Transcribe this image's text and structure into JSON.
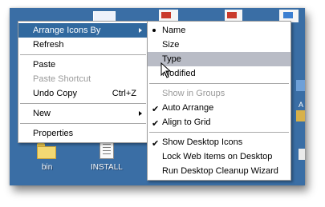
{
  "desktop": {
    "icons": [
      {
        "label": "bin"
      },
      {
        "label": "INSTALL"
      }
    ],
    "edge_label_partial": "A"
  },
  "context_menu": {
    "items": [
      {
        "label": "Arrange Icons By"
      },
      {
        "label": "Refresh"
      },
      {
        "label": "Paste"
      },
      {
        "label": "Paste Shortcut"
      },
      {
        "label": "Undo Copy",
        "shortcut": "Ctrl+Z"
      },
      {
        "label": "New"
      },
      {
        "label": "Properties"
      }
    ]
  },
  "submenu": {
    "items": [
      {
        "label": "Name"
      },
      {
        "label": "Size"
      },
      {
        "label": "Type"
      },
      {
        "label": "Modified"
      },
      {
        "label": "Show in Groups"
      },
      {
        "label": "Auto Arrange"
      },
      {
        "label": "Align to Grid"
      },
      {
        "label": "Show Desktop Icons"
      },
      {
        "label": "Lock Web Items on Desktop"
      },
      {
        "label": "Run Desktop Cleanup Wizard"
      }
    ]
  },
  "colors": {
    "desktop": "#3a6ea5",
    "highlight": "#31699f",
    "hover": "#b9bcc6"
  }
}
